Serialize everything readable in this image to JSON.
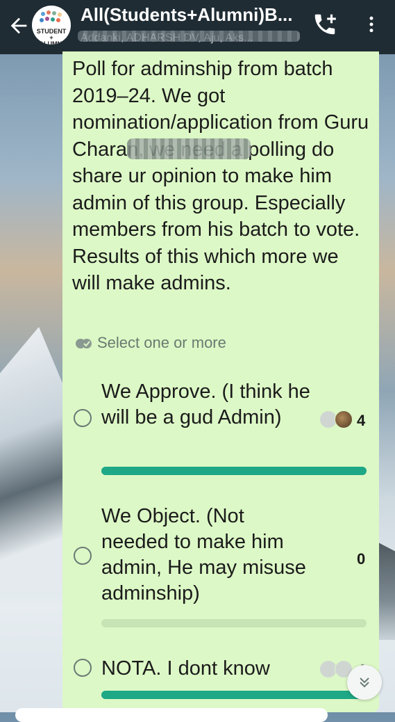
{
  "header": {
    "title": "All(Students+Alumni)B...",
    "subtitle": "Addanki, ADHARSH DV, Aju, Aks...",
    "avatar_text": "STUDENT\n+\nALUMNI"
  },
  "message": {
    "text": "Poll for adminship from batch 2019–24. We got nomination/application from Guru Charan, we need a polling do share ur opinion to make him admin of this group. Especially members from his batch to vote. Results of this which more we will make admins."
  },
  "poll": {
    "hint": "Select one or more",
    "options": [
      {
        "label": "We Approve. (I think he will be a gud Admin)",
        "count": "4",
        "fraction": 1.0
      },
      {
        "label": "We Object. (Not needed to make him admin, He may misuse adminship)",
        "count": "0",
        "fraction": 0.0
      },
      {
        "label": "NOTA. I dont know",
        "count": "4",
        "fraction": 1.0
      }
    ]
  },
  "colors": {
    "header_bg": "#1f2c34",
    "bubble_bg": "#dcf8c6",
    "bar_fill": "#1ea885",
    "bar_track": "#c6e4b5"
  },
  "icons": [
    "back-arrow-icon",
    "call-add-icon",
    "more-vert-icon",
    "check-double-icon",
    "double-chevron-down-icon"
  ]
}
